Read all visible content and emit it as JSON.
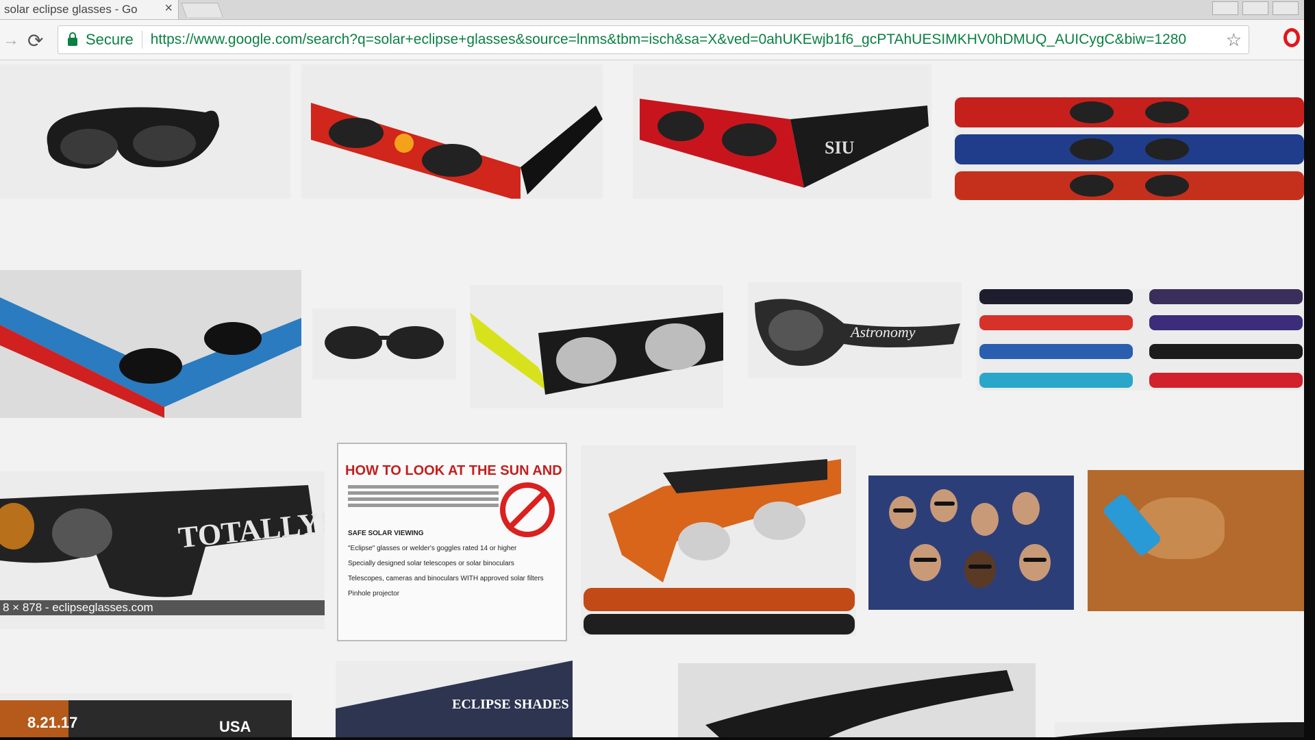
{
  "browser": {
    "tab_title": "solar eclipse glasses - Go",
    "tab_close": "×",
    "secure_label": "Secure",
    "url": "https://www.google.com/search?q=solar+eclipse+glasses&source=lnms&tbm=isch&sa=X&ved=0ahUKEwjb1f6_gcPTAhUESIMKHV0hDMUQ_AUICygC&biw=1280",
    "icons": {
      "back": "back-arrow-icon",
      "reload": "reload-icon",
      "lock": "lock-icon",
      "star": "star-icon",
      "opera": "opera-icon"
    }
  },
  "results": {
    "caption": "8 × 878 - eclipseglasses.com",
    "poster_title": "HOW TO LOOK AT THE SUN AND NOT GO BLIND",
    "poster_bullets": [
      "SAFE SOLAR VIEWING",
      "\"Eclipse\" glasses or welder's goggles rated 14 or higher",
      "Specially designed solar telescopes or solar binoculars",
      "Telescopes, cameras and binoculars WITH approved solar filters",
      "Pinhole projector"
    ],
    "totally_text": "TOTALLY!",
    "siu_text": "SIU",
    "astronomy_text": "Astronomy",
    "shades_text": "ECLIPSE SHADES",
    "usa_text": "USA",
    "date_text": "8.21.17"
  },
  "colors": {
    "secure_green": "#0b8043",
    "opera_red": "#e0171b",
    "poster_red": "#c41e1e"
  }
}
